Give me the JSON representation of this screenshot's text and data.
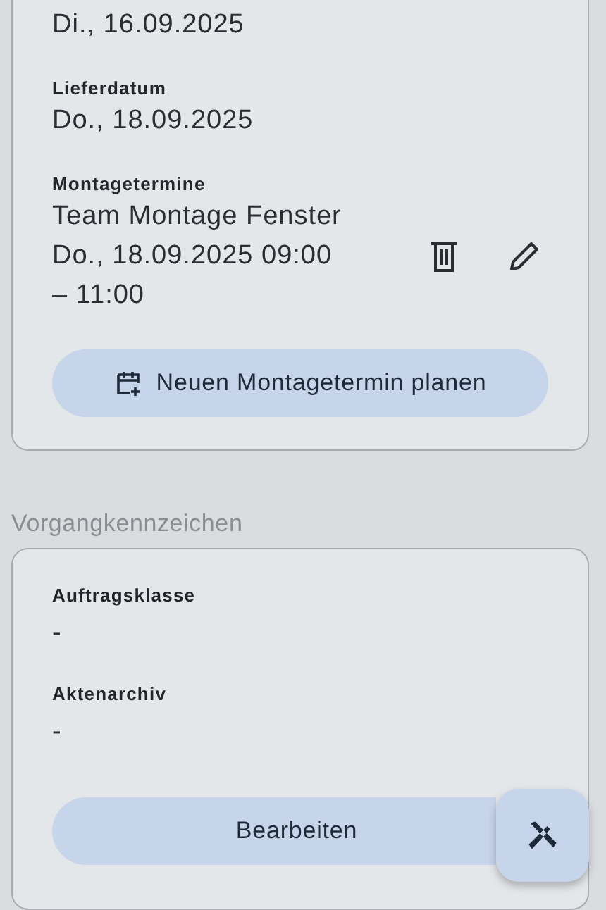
{
  "dates_card": {
    "fields": [
      {
        "value": "Di., 16.09.2025"
      },
      {
        "label": "Lieferdatum",
        "value": "Do., 18.09.2025"
      }
    ],
    "appointments": {
      "label": "Montagetermine",
      "items": [
        {
          "team": "Team Montage Fenster",
          "time": "Do., 18.09.2025 09:00 – 11:00"
        }
      ]
    },
    "button": "Neuen Montagetermin planen"
  },
  "section_title": "Vorgangkennzeichen",
  "flags_card": {
    "fields": [
      {
        "label": "Auftragsklasse",
        "value": "-"
      },
      {
        "label": "Aktenarchiv",
        "value": "-"
      }
    ],
    "button": "Bearbeiten"
  }
}
